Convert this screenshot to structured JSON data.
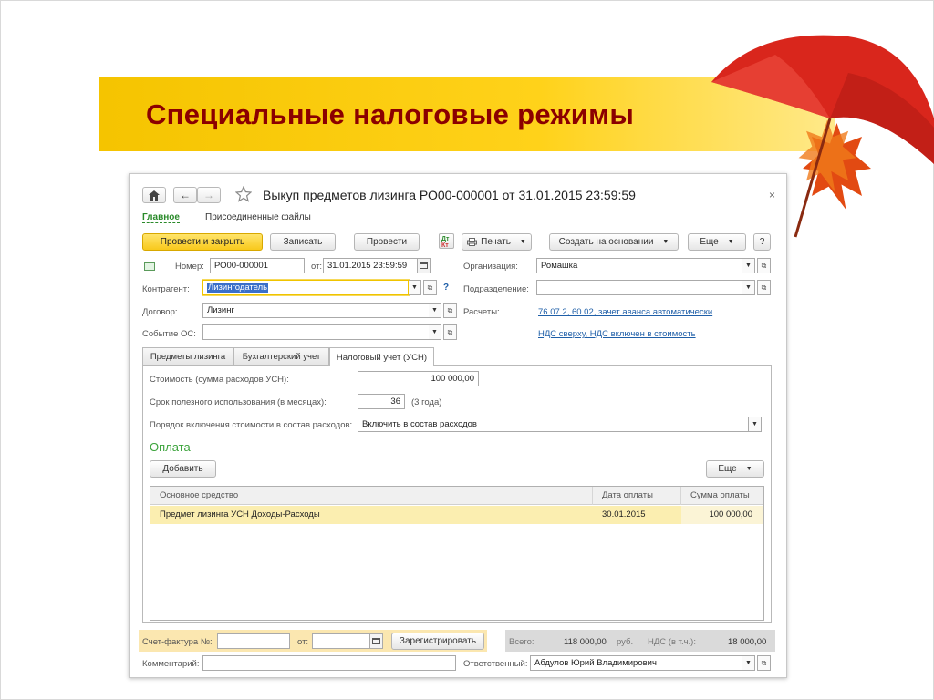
{
  "slide": {
    "title": "Специальные налоговые режимы"
  },
  "colors": {
    "banner": "#f5c400",
    "title": "#8b0000",
    "primary_button": "#f8c91c",
    "link": "#1f5fa8",
    "section": "#3ba33b",
    "selected_row": "#fbeeb0"
  },
  "window": {
    "title": "Выкуп предметов лизинга РО00-000001 от 31.01.2015 23:59:59",
    "nav_tabs": [
      "Главное",
      "Присоединенные файлы"
    ],
    "close_icon": "close-icon",
    "home_icon": "home-icon",
    "star_icon": "star-icon"
  },
  "toolbar": {
    "post_close": "Провести и закрыть",
    "save": "Записать",
    "post": "Провести",
    "dt_kt": "Дт\nКт",
    "print": "Печать",
    "create_based_on": "Создать на основании",
    "more": "Еще",
    "help": "?"
  },
  "header": {
    "number_label": "Номер:",
    "number_value": "РО00-000001",
    "date_label": "от:",
    "date_value": "31.01.2015 23:59:59",
    "org_label": "Организация:",
    "org_value": "Ромашка",
    "counterparty_label": "Контрагент:",
    "counterparty_value": "Лизингодатель",
    "counterparty_help": "?",
    "division_label": "Подразделение:",
    "division_value": "",
    "contract_label": "Договор:",
    "contract_value": "Лизинг",
    "settlements_label": "Расчеты:",
    "settlements_link": "76.07.2, 60.02, зачет аванса автоматически",
    "vat_link": "НДС сверху, НДС включен в стоимость",
    "event_label": "Событие ОС:",
    "event_value": ""
  },
  "tabs": [
    "Предметы лизинга",
    "Бухгалтерский учет",
    "Налоговый учет (УСН)"
  ],
  "tax": {
    "cost_label": "Стоимость (сумма расходов УСН):",
    "cost_value": "100 000,00",
    "term_label": "Срок полезного использования (в месяцах):",
    "term_value": "36",
    "term_note": "(3 года)",
    "order_label": "Порядок включения стоимости в состав расходов:",
    "order_value": "Включить в состав расходов"
  },
  "payment": {
    "section_title": "Оплата",
    "add_button": "Добавить",
    "more_button": "Еще",
    "columns": [
      "Основное средство",
      "Дата оплаты",
      "Сумма оплаты"
    ],
    "rows": [
      {
        "asset": "Предмет лизинга УСН Доходы-Расходы",
        "date": "30.01.2015",
        "amount": "100 000,00"
      }
    ]
  },
  "footer": {
    "invoice_label": "Счет-фактура №:",
    "invoice_value": "",
    "from_label": "от:",
    "from_value": ". .",
    "register_button": "Зарегистрировать",
    "total_label": "Всего:",
    "total_value": "118 000,00",
    "currency": "руб.",
    "vat_label": "НДС (в т.ч.):",
    "vat_value": "18 000,00",
    "comment_label": "Комментарий:",
    "comment_value": "",
    "responsible_label": "Ответственный:",
    "responsible_value": "Абдулов Юрий Владимирович"
  }
}
